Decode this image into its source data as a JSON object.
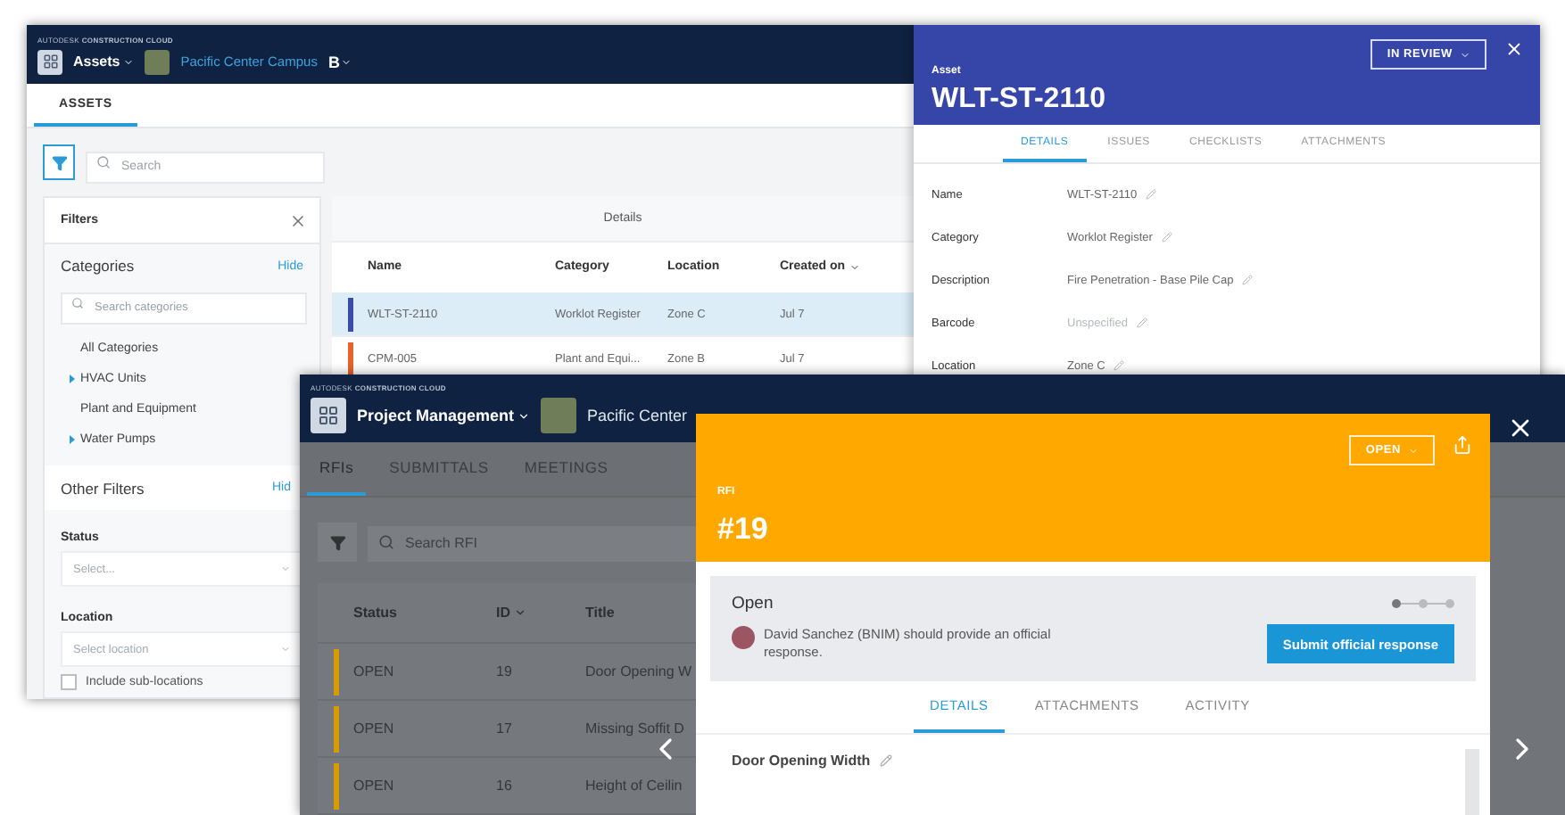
{
  "assets_window": {
    "brand": "AUTODESK **CONSTRUCTION CLOUD**",
    "app_menu": "Assets",
    "project": "Pacific Center Campus",
    "project_badge": "B",
    "tabs": [
      {
        "label": "ASSETS",
        "selected": true
      }
    ],
    "search": {
      "placeholder": "Search"
    },
    "filters": {
      "title": "Filters",
      "categories": {
        "title": "Categories",
        "action": "Hide",
        "search_placeholder": "Search categories",
        "items": [
          {
            "label": "All Categories",
            "expandable": false
          },
          {
            "label": "HVAC Units",
            "expandable": true
          },
          {
            "label": "Plant and Equipment",
            "expandable": false
          },
          {
            "label": "Water Pumps",
            "expandable": true
          }
        ]
      },
      "other_filters": {
        "title": "Other Filters",
        "action": "Hid"
      },
      "status": {
        "label": "Status",
        "placeholder": "Select..."
      },
      "location": {
        "label": "Location",
        "placeholder": "Select location"
      },
      "include_sublocations": {
        "label": "Include sub-locations",
        "checked": false
      }
    },
    "table": {
      "group_header": "Details",
      "columns": [
        {
          "label": "Name",
          "sorted": false
        },
        {
          "label": "Category",
          "sorted": false
        },
        {
          "label": "Location",
          "sorted": false
        },
        {
          "label": "Created on",
          "sorted": true
        }
      ],
      "rows": [
        {
          "cells": [
            "WLT-ST-2110",
            "Worklot Register",
            "Zone C",
            "Jul 7"
          ],
          "color": "#3b4ba8",
          "selected": true
        },
        {
          "cells": [
            "CPM-005",
            "Plant and Equi...",
            "Zone B",
            "Jul 7"
          ],
          "color": "#e8622c",
          "selected": false
        }
      ]
    }
  },
  "asset_panel": {
    "label": "Asset",
    "title": "WLT-ST-2110",
    "status": "IN REVIEW",
    "tabs": [
      {
        "label": "DETAILS",
        "selected": true
      },
      {
        "label": "ISSUES",
        "selected": false
      },
      {
        "label": "CHECKLISTS",
        "selected": false
      },
      {
        "label": "ATTACHMENTS",
        "selected": false
      }
    ],
    "fields": [
      {
        "label": "Name",
        "value": "WLT-ST-2110",
        "muted": false
      },
      {
        "label": "Category",
        "value": "Worklot Register",
        "muted": false
      },
      {
        "label": "Description",
        "value": "Fire Penetration - Base Pile Cap",
        "muted": false
      },
      {
        "label": "Barcode",
        "value": "Unspecified",
        "muted": true
      },
      {
        "label": "Location",
        "value": "Zone C",
        "muted": false
      }
    ]
  },
  "rfi_window": {
    "brand": "AUTODESK **CONSTRUCTION CLOUD**",
    "app_menu": "Project Management",
    "project": "Pacific Center",
    "tabs": [
      {
        "label": "RFIs",
        "selected": true
      },
      {
        "label": "SUBMITTALS",
        "selected": false
      },
      {
        "label": "MEETINGS",
        "selected": false
      }
    ],
    "search": {
      "placeholder": "Search RFI"
    },
    "table": {
      "columns": [
        {
          "label": "Status",
          "sorted": false
        },
        {
          "label": "ID",
          "sorted": true
        },
        {
          "label": "Title",
          "sorted": false
        }
      ],
      "rows": [
        {
          "cells": [
            "OPEN",
            "19",
            "Door Opening W"
          ],
          "color": "#d89b00"
        },
        {
          "cells": [
            "OPEN",
            "17",
            "Missing Soffit D"
          ],
          "color": "#d89b00"
        },
        {
          "cells": [
            "OPEN",
            "16",
            "Height of Ceilin"
          ],
          "color": "#d89b00"
        }
      ]
    }
  },
  "rfi_panel": {
    "label": "RFI",
    "title": "#19",
    "status": "OPEN",
    "workflow": {
      "state": "Open",
      "steps": [
        {
          "current": true
        },
        {
          "current": false
        },
        {
          "current": false
        }
      ],
      "message": "David Sanchez (BNIM) should provide an official response.",
      "action": "Submit official response"
    },
    "tabs": [
      {
        "label": "DETAILS",
        "selected": true
      },
      {
        "label": "ATTACHMENTS",
        "selected": false
      },
      {
        "label": "ACTIVITY",
        "selected": false
      }
    ],
    "fields": [
      {
        "label": "Door Opening Width"
      }
    ]
  }
}
